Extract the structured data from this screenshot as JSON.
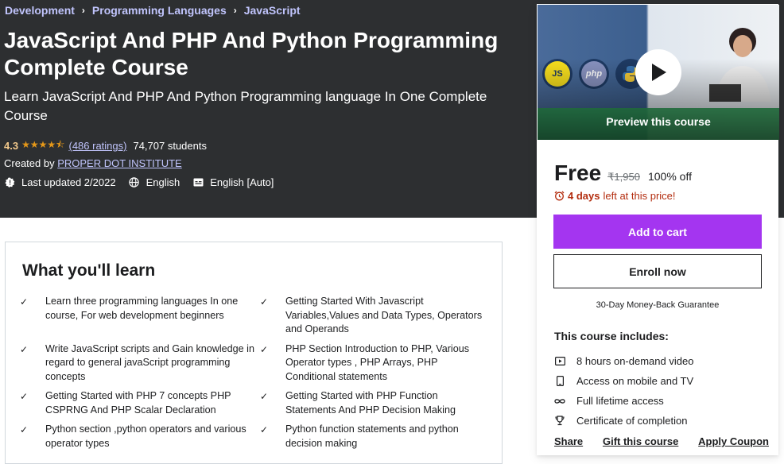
{
  "breadcrumb": [
    "Development",
    "Programming Languages",
    "JavaScript"
  ],
  "course": {
    "title": "JavaScript And PHP And Python Programming Complete Course",
    "subtitle": "Learn JavaScript And PHP And Python Programming language In One Complete Course",
    "rating": "4.3",
    "stars": "★★★★⯪",
    "ratings_link": "(486 ratings)",
    "students": "74,707 students",
    "created_by_label": "Created by",
    "instructor": "PROPER DOT INSTITUTE",
    "last_updated": "Last updated 2/2022",
    "language": "English",
    "captions": "English [Auto]"
  },
  "sidebar": {
    "preview_label": "Preview this course",
    "badges": [
      "JS",
      "php"
    ],
    "price": "Free",
    "original_price": "₹1,950",
    "discount": "100% off",
    "timer_bold": "4 days",
    "timer_text": "left at this price!",
    "add_to_cart": "Add to cart",
    "enroll_now": "Enroll now",
    "guarantee": "30-Day Money-Back Guarantee",
    "includes_title": "This course includes:",
    "includes": [
      {
        "icon": "video-icon",
        "text": "8 hours on-demand video"
      },
      {
        "icon": "mobile-icon",
        "text": "Access on mobile and TV"
      },
      {
        "icon": "infinity-icon",
        "text": "Full lifetime access"
      },
      {
        "icon": "trophy-icon",
        "text": "Certificate of completion"
      }
    ],
    "links": [
      "Share",
      "Gift this course",
      "Apply Coupon"
    ]
  },
  "learn": {
    "title": "What you'll learn",
    "items": [
      "Learn three programming languages In one course, For web development beginners",
      "Getting Started With Javascript Variables,Values and Data Types, Operators and Operands",
      "Write JavaScript scripts and Gain knowledge in regard to general javaScript programming concepts",
      "PHP Section Introduction to PHP, Various Operator types , PHP Arrays, PHP Conditional statements",
      "Getting Started with PHP 7 concepts PHP CSPRNG And PHP Scalar Declaration",
      "Getting Started with PHP Function Statements And PHP Decision Making",
      "Python section ,python operators and various operator types",
      "Python function statements and python decision making"
    ]
  },
  "colors": {
    "hero_bg": "#2d2f31",
    "accent_purple": "#a435f0",
    "link_lavender": "#c0c4fc",
    "rating_gold": "#f3ca8c",
    "timer_red": "#b32d0f"
  }
}
